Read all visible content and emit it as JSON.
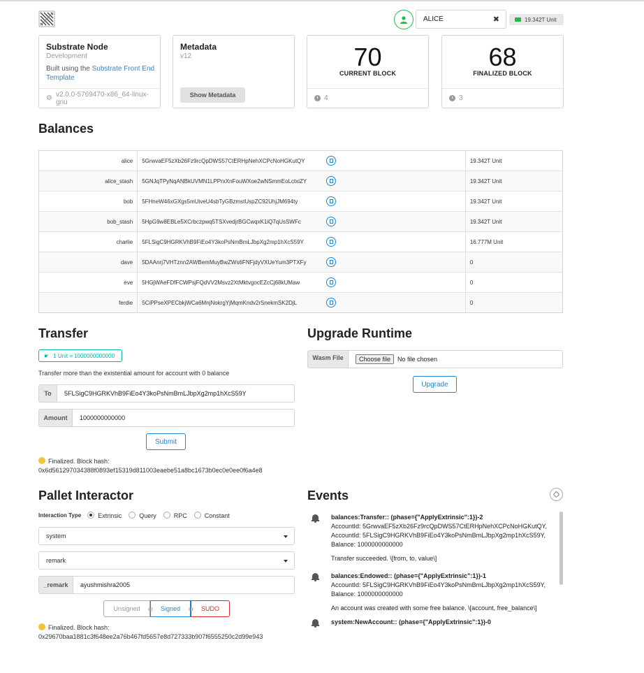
{
  "header": {
    "account_name": "ALICE",
    "balance_badge": "19.342T Unit"
  },
  "cards": {
    "node": {
      "title": "Substrate Node",
      "meta": "Development",
      "desc_prefix": "Built using the ",
      "desc_link": "Substrate Front End Template",
      "version": "v2.0.0-5769470-x86_64-linux-gnu"
    },
    "metadata": {
      "title": "Metadata",
      "meta": "v12",
      "button": "Show Metadata"
    },
    "current_block": {
      "value": "70",
      "label": "CURRENT BLOCK",
      "timer": "4"
    },
    "finalized_block": {
      "value": "68",
      "label": "FINALIZED BLOCK",
      "timer": "3"
    }
  },
  "balances": {
    "title": "Balances",
    "rows": [
      {
        "name": "alice",
        "address": "5GrwvaEF5zXb26Fz9rcQpDWS57CtERHpNehXCPcNoHGKutQY",
        "balance": "19.342T Unit"
      },
      {
        "name": "alice_stash",
        "address": "5GNJqTPyNqANBkUVMN1LPPrxXnFouWXoe2wNSmmEoLctxiZY",
        "balance": "19.342T Unit"
      },
      {
        "name": "bob",
        "address": "5FHneW46xGXgs5mUiveU4sbTyGBzmstUspZC92UhjJM694ty",
        "balance": "19.342T Unit"
      },
      {
        "name": "bob_stash",
        "address": "5HpG9w8EBLe5XCrbczpwq5TSXvedjrBGCwqxK1iQ7qUsSWFc",
        "balance": "19.342T Unit"
      },
      {
        "name": "charlie",
        "address": "5FLSigC9HGRKVhB9FiEo4Y3koPsNmBmLJbpXg2mp1hXcS59Y",
        "balance": "16.777M Unit"
      },
      {
        "name": "dave",
        "address": "5DAAnrj7VHTznn2AWBemMuyBwZWs6FNFjdyVXUeYum3PTXFy",
        "balance": "0"
      },
      {
        "name": "eve",
        "address": "5HGjWAeFDfFCWPsjFQdVV2Msvz2XtMktvgocEZcCj68kUMaw",
        "balance": "0"
      },
      {
        "name": "ferdie",
        "address": "5CiPPseXPECbkjWCa6MnjNokrgYjMqmKndv2rSnekmSK2DjL",
        "balance": "0"
      }
    ]
  },
  "transfer": {
    "title": "Transfer",
    "unit_badge": "1 Unit = 1000000000000",
    "hint": "Transfer more than the existential amount for account with 0 balance",
    "to_label": "To",
    "to_value": "5FLSigC9HGRKVhB9FiEo4Y3koPsNmBmLJbpXg2mp1hXcS59Y",
    "amount_label": "Amount",
    "amount_value": "1000000000000",
    "submit": "Submit",
    "status_line1": "Finalized. Block hash:",
    "status_line2": "0x6d561297034388f0893ef15319d811003eaebe51a8bc1673b0ec0e0ee0f6a4e8"
  },
  "upgrade": {
    "title": "Upgrade Runtime",
    "wasm_label": "Wasm File",
    "choose_file": "Choose file",
    "no_file": "No file chosen",
    "button": "Upgrade"
  },
  "pallet": {
    "title": "Pallet Interactor",
    "type_label": "Interaction Type",
    "types": [
      "Extrinsic",
      "Query",
      "RPC",
      "Constant"
    ],
    "pallet_value": "system",
    "callable_value": "remark",
    "param_label": "_remark",
    "param_value": "ayushmishra2005",
    "btn_unsigned": "Unsigned",
    "or1": "or",
    "btn_signed": "Signed",
    "or2": "or",
    "btn_sudo": "SUDO",
    "status_line1": "Finalized. Block hash:",
    "status_line2": "0x29670baa1881c3f648ee2a76b467fd5657e8d727333b907f6555250c2d99e943"
  },
  "events": {
    "title": "Events",
    "items": [
      {
        "head": "balances:Transfer:: (phase={\"ApplyExtrinsic\":1})-2",
        "lines": [
          "AccountId: 5GrwvaEF5zXb26Fz9rcQpDWS57CtERHpNehXCPcNoHGKutQY,",
          "AccountId: 5FLSigC9HGRKVhB9FiEo4Y3koPsNmBmLJbpXg2mp1hXcS59Y,",
          "Balance: 1000000000000"
        ],
        "desc": "Transfer succeeded. \\[from, to, value\\]"
      },
      {
        "head": "balances:Endowed:: (phase={\"ApplyExtrinsic\":1})-1",
        "lines": [
          "AccountId: 5FLSigC9HGRKVhB9FiEo4Y3koPsNmBmLJbpXg2mp1hXcS59Y,",
          "Balance: 1000000000000"
        ],
        "desc": "An account was created with some free balance. \\[account, free_balance\\]"
      },
      {
        "head": "system:NewAccount:: (phase={\"ApplyExtrinsic\":1})-0",
        "lines": [],
        "desc": ""
      }
    ]
  },
  "colors": {
    "link": "#4183c4",
    "primary": "#2185d0",
    "teal": "#00b5ad",
    "green": "#21ba45",
    "red": "#db2828"
  }
}
